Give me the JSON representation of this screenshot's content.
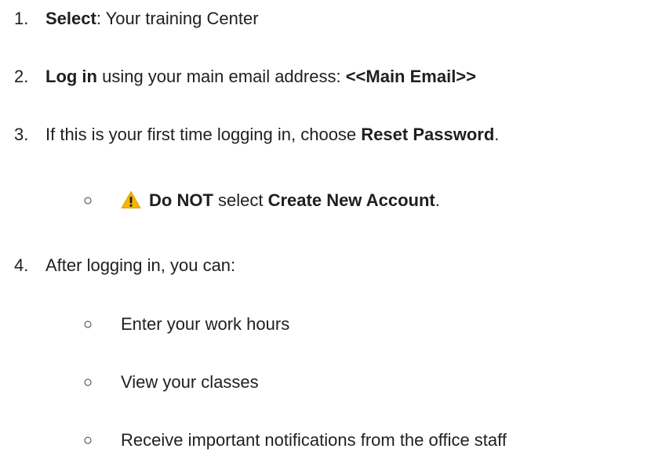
{
  "steps": [
    {
      "number": "1.",
      "bold": "Select",
      "rest": ": Your training Center"
    },
    {
      "number": "2.",
      "bold": "Log in",
      "middle": " using your main email address: ",
      "bold2": "<<Main Email>>"
    },
    {
      "number": "3.",
      "prefix": "If this is your first time logging in, choose ",
      "bold": "Reset Password",
      "suffix": ".",
      "sub": {
        "bullet": "○",
        "icon": "warning-icon",
        "bold": "Do NOT",
        "middle": " select ",
        "bold2": "Create New Account",
        "suffix": "."
      }
    },
    {
      "number": "4.",
      "text": "After logging in, you can:",
      "subs": [
        {
          "bullet": "○",
          "text": "Enter your work hours"
        },
        {
          "bullet": "○",
          "text": "View your classes"
        },
        {
          "bullet": "○",
          "text": "Receive important notifications from the office staff"
        }
      ]
    }
  ],
  "colors": {
    "text": "#1f1f1f",
    "warning": "#f5b400"
  }
}
